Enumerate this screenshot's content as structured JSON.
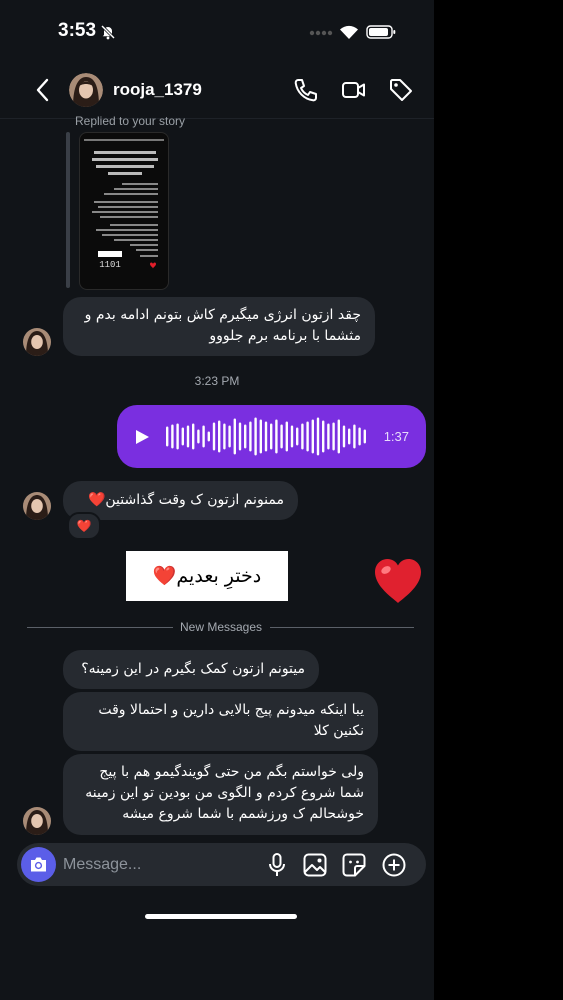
{
  "status_bar": {
    "time": "3:53",
    "icons": [
      "bell-slash-icon",
      "signal-dots-icon",
      "wifi-icon",
      "battery-icon"
    ]
  },
  "header": {
    "username": "rooja_1379",
    "icons": [
      "back-chevron-icon",
      "phone-icon",
      "video-camera-icon",
      "tag-icon"
    ]
  },
  "conversation": {
    "story_reply": {
      "caption": "Replied to your story",
      "story_counter": "1101"
    },
    "incoming_1": {
      "line1": "چقد ازتون انرژی میگیرم کاش بتونم ادامه بدم و",
      "line2": "مثشما با برنامه برم جلووو"
    },
    "timestamp": "3:23 PM",
    "voice_message": {
      "duration": "1:37",
      "icon": "play-icon"
    },
    "incoming_2": {
      "text": "ممنونم ازتون ک وقت گذاشتین❤️",
      "reaction": "❤️"
    },
    "sticker": {
      "text": "دخترِ بعدیم❤️"
    },
    "big_heart": "❤️",
    "divider": "New Messages",
    "incoming_3": {
      "text": "میتونم ازتون کمک بگیرم در این زمینه؟"
    },
    "incoming_4": {
      "line1": "یبا اینکه میدونم پیج بالایی دارین و احتمالا وقت",
      "line2": "نکنین کلا"
    },
    "incoming_5": {
      "line1": "ولی خواستم بگم من حتی گویندگیمو هم با پیج",
      "line2": "شما شروع کردم و الگوی من بودین تو این زمینه",
      "line3": "خوشحالم ک ورزشمم با شما شروع میشه"
    }
  },
  "composer": {
    "placeholder": "Message...",
    "icons": [
      "camera-icon",
      "microphone-icon",
      "gallery-icon",
      "sticker-icon",
      "add-icon"
    ]
  },
  "colors": {
    "background": "#111418",
    "bubble_incoming": "#262a30",
    "voice_bubble": "#7a2fe0",
    "camera_button": "#5b5ee8"
  }
}
